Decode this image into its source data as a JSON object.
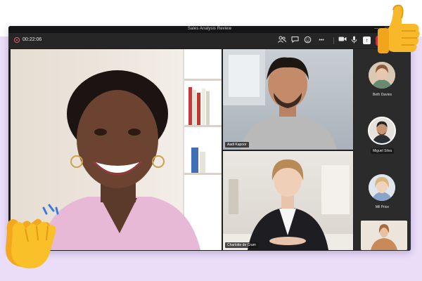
{
  "meeting": {
    "title": "Sales Analysis Review",
    "timer": "00:22:06"
  },
  "window_controls": {
    "minimize": "—",
    "maximize": "☐",
    "close": "✕"
  },
  "toolbar": {
    "icons": [
      "people-icon",
      "chat-icon",
      "reactions-icon",
      "more-icon",
      "camera-icon",
      "microphone-icon",
      "share-screen-icon",
      "leave-call-icon"
    ],
    "more_label": "•••",
    "share_glyph": "↑"
  },
  "participants": {
    "main": {
      "name": ""
    },
    "tile_a": {
      "name": "Aadi Kapoor"
    },
    "tile_b": {
      "name": "Charlotte de Crum"
    }
  },
  "side_panel": {
    "people": [
      {
        "name": "Beth Davies"
      },
      {
        "name": "Miguel Silva"
      },
      {
        "name": "Mil Price"
      }
    ]
  },
  "reactions": [
    "thumbs-up-emoji",
    "clapping-hands-emoji"
  ],
  "colors": {
    "background_band": "#e9ddf7",
    "leave_button": "#c4314b",
    "recording": "#e06070",
    "emoji_yellow": "#f9c02a"
  }
}
